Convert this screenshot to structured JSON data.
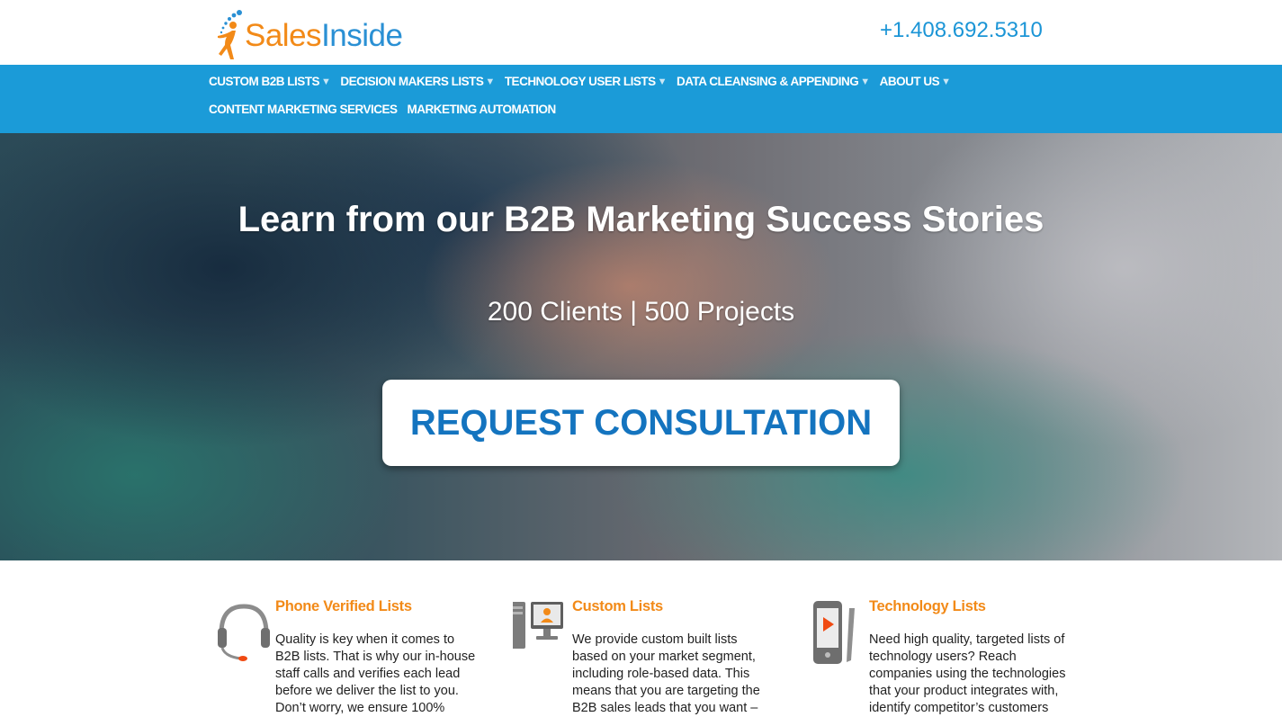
{
  "brand": {
    "name_part1": "Sales",
    "name_part2": "Inside",
    "colors": {
      "orange": "#f28a18",
      "blue": "#2a90d4"
    }
  },
  "header": {
    "phone": "+1.408.692.5310"
  },
  "nav": {
    "row1": [
      {
        "label": "CUSTOM B2B LISTS",
        "has_dropdown": true
      },
      {
        "label": "DECISION MAKERS LISTS",
        "has_dropdown": true
      },
      {
        "label": "TECHNOLOGY USER LISTS",
        "has_dropdown": true
      },
      {
        "label": "DATA CLEANSING & APPENDING",
        "has_dropdown": true
      },
      {
        "label": "ABOUT US",
        "has_dropdown": true
      }
    ],
    "row2": [
      {
        "label": "CONTENT MARKETING SERVICES"
      },
      {
        "label": "MARKETING AUTOMATION"
      }
    ],
    "caret": "▼"
  },
  "hero": {
    "title": "Learn from our B2B Marketing Success Stories",
    "subtitle": "200 Clients | 500 Projects",
    "cta_label": "REQUEST CONSULTATION"
  },
  "features": [
    {
      "icon": "headset-icon",
      "title": "Phone Verified Lists",
      "text": "Quality is key when it comes to B2B lists. That is why our in-house staff calls and verifies each lead before we deliver the list to you. Don’t worry, we ensure 100%"
    },
    {
      "icon": "computer-user-icon",
      "title": "Custom Lists",
      "text": "We provide custom built lists based on your market segment, including role-based data. This means that you are targeting the B2B sales leads that you want –"
    },
    {
      "icon": "tablet-play-icon",
      "title": "Technology Lists",
      "text": "Need high quality, targeted lists of technology users? Reach companies using the technologies that your product integrates with, identify competitor’s customers"
    }
  ]
}
